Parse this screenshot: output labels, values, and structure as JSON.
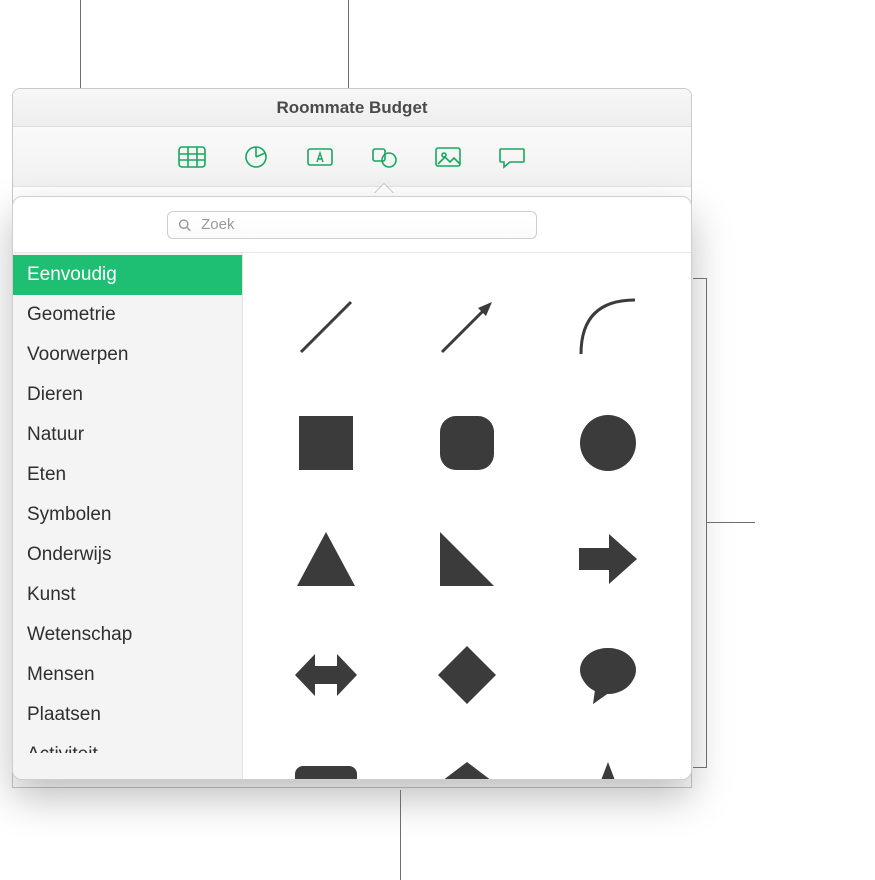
{
  "window": {
    "title": "Roommate Budget"
  },
  "toolbar": {
    "buttons": [
      {
        "name": "table-icon"
      },
      {
        "name": "chart-icon"
      },
      {
        "name": "textbox-icon"
      },
      {
        "name": "shape-icon",
        "active": true
      },
      {
        "name": "media-icon"
      },
      {
        "name": "comment-icon"
      }
    ]
  },
  "search": {
    "placeholder": "Zoek"
  },
  "sidebar": {
    "items": [
      {
        "label": "Eenvoudig",
        "selected": true
      },
      {
        "label": "Geometrie"
      },
      {
        "label": "Voorwerpen"
      },
      {
        "label": "Dieren"
      },
      {
        "label": "Natuur"
      },
      {
        "label": "Eten"
      },
      {
        "label": "Symbolen"
      },
      {
        "label": "Onderwijs"
      },
      {
        "label": "Kunst"
      },
      {
        "label": "Wetenschap"
      },
      {
        "label": "Mensen"
      },
      {
        "label": "Plaatsen"
      },
      {
        "label": "Activiteit",
        "clipped": true
      }
    ]
  },
  "shapes": [
    "line",
    "arrow-line",
    "curve",
    "square",
    "rounded-square",
    "circle",
    "triangle",
    "right-triangle",
    "arrow-right",
    "double-arrow",
    "diamond",
    "speech-bubble",
    "speech-rect",
    "pentagon",
    "star"
  ]
}
